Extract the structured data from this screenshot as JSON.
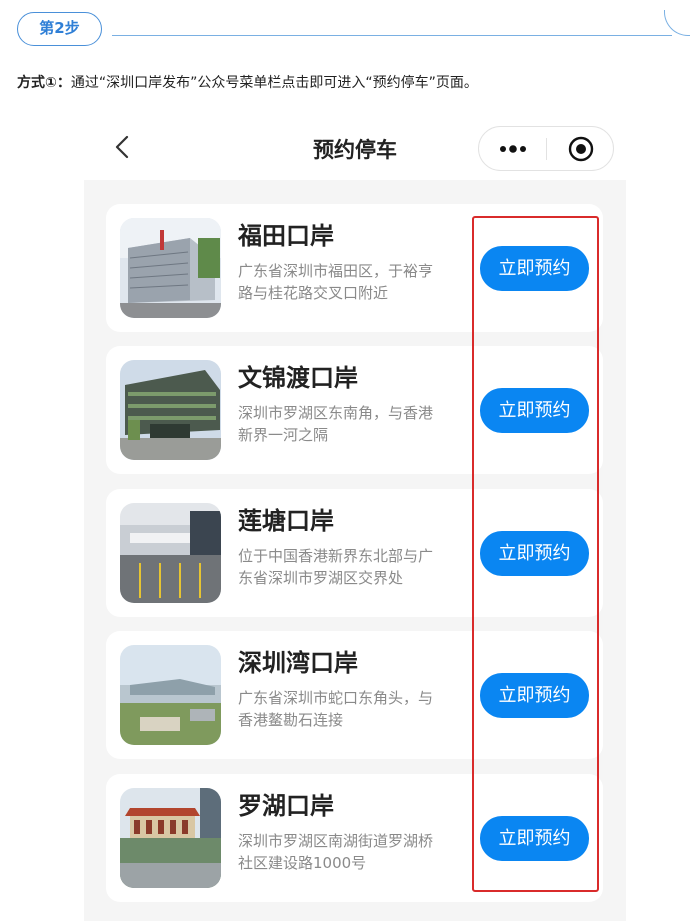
{
  "step": {
    "label": "第2步"
  },
  "instruction": {
    "method_label": "方式①：",
    "text": "通过“深圳口岸发布”公众号菜单栏点击即可进入“预约停车”页面。"
  },
  "nav": {
    "title": "预约停车",
    "icons": {
      "back": "chevron-left-icon",
      "more": "more-dots-icon",
      "close": "target-circle-icon"
    }
  },
  "ports": [
    {
      "name": "福田口岸",
      "address": "广东省深圳市福田区，于裕亨路与桂花路交叉口附近",
      "button": "立即预约"
    },
    {
      "name": "文锦渡口岸",
      "address": "深圳市罗湖区东南角，与香港新界一河之隔",
      "button": "立即预约"
    },
    {
      "name": "莲塘口岸",
      "address": "位于中国香港新界东北部与广东省深圳市罗湖区交界处",
      "button": "立即预约"
    },
    {
      "name": "深圳湾口岸",
      "address": "广东省深圳市蛇口东角头，与香港鳌勘石连接",
      "button": "立即预约"
    },
    {
      "name": "罗湖口岸",
      "address": "深圳市罗湖区南湖街道罗湖桥社区建设路1000号",
      "button": "立即预约"
    }
  ],
  "colors": {
    "accent": "#0a86f2",
    "highlight": "#d92b2b",
    "step_border": "#4a90d9"
  }
}
